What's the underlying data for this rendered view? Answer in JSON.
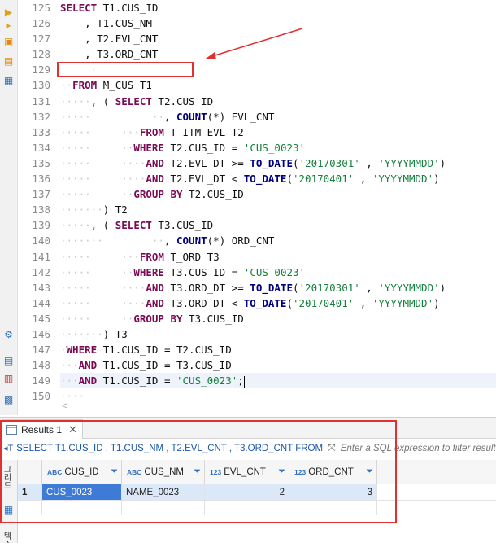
{
  "editor": {
    "line_numbers": [
      "125",
      "126",
      "127",
      "128",
      "129",
      "130",
      "131",
      "132",
      "133",
      "134",
      "135",
      "136",
      "137",
      "138",
      "139",
      "140",
      "141",
      "142",
      "143",
      "144",
      "145",
      "146",
      "147",
      "148",
      "149",
      "150"
    ],
    "lines": [
      [
        {
          "t": "SELECT",
          "c": "kw"
        },
        {
          "t": " T1.CUS_ID"
        }
      ],
      [
        {
          "t": "    ",
          "c": "dot"
        },
        {
          "t": ", T1.CUS_NM"
        }
      ],
      [
        {
          "t": "    ",
          "c": "dot"
        },
        {
          "t": ", T2.EVL_CNT"
        }
      ],
      [
        {
          "t": "    ",
          "c": "dot"
        },
        {
          "t": ", T3.ORD_CNT"
        }
      ],
      [
        {
          "t": "     ·",
          "c": "dot"
        }
      ],
      [
        {
          "t": "··",
          "c": "dot"
        },
        {
          "t": "FROM",
          "c": "kw"
        },
        {
          "t": " M_CUS T1"
        }
      ],
      [
        {
          "t": "·····",
          "c": "dot"
        },
        {
          "t": ", ( "
        },
        {
          "t": "SELECT",
          "c": "kw"
        },
        {
          "t": " T2.CUS_ID"
        }
      ],
      [
        {
          "t": "·····          ··",
          "c": "dot"
        },
        {
          "t": ", "
        },
        {
          "t": "COUNT",
          "c": "fn"
        },
        {
          "t": "(*) EVL_CNT"
        }
      ],
      [
        {
          "t": "·····     ···",
          "c": "dot"
        },
        {
          "t": "FROM",
          "c": "kw"
        },
        {
          "t": " T_ITM_EVL T2"
        }
      ],
      [
        {
          "t": "·····     ··",
          "c": "dot"
        },
        {
          "t": "WHERE",
          "c": "kw"
        },
        {
          "t": " T2.CUS_ID = "
        },
        {
          "t": "'CUS_0023'",
          "c": "str"
        }
      ],
      [
        {
          "t": "·····     ····",
          "c": "dot"
        },
        {
          "t": "AND",
          "c": "kw"
        },
        {
          "t": " T2.EVL_DT >= "
        },
        {
          "t": "TO_DATE",
          "c": "fn"
        },
        {
          "t": "("
        },
        {
          "t": "'20170301'",
          "c": "str"
        },
        {
          "t": " , "
        },
        {
          "t": "'YYYYMMDD'",
          "c": "str"
        },
        {
          "t": ")"
        }
      ],
      [
        {
          "t": "·····     ····",
          "c": "dot"
        },
        {
          "t": "AND",
          "c": "kw"
        },
        {
          "t": " T2.EVL_DT < "
        },
        {
          "t": "TO_DATE",
          "c": "fn"
        },
        {
          "t": "("
        },
        {
          "t": "'20170401'",
          "c": "str"
        },
        {
          "t": " , "
        },
        {
          "t": "'YYYYMMDD'",
          "c": "str"
        },
        {
          "t": ")"
        }
      ],
      [
        {
          "t": "·····     ··",
          "c": "dot"
        },
        {
          "t": "GROUP BY",
          "c": "kw"
        },
        {
          "t": " T2.CUS_ID"
        }
      ],
      [
        {
          "t": "·······",
          "c": "dot"
        },
        {
          "t": ") T2"
        }
      ],
      [
        {
          "t": "·····",
          "c": "dot"
        },
        {
          "t": ", ( "
        },
        {
          "t": "SELECT",
          "c": "kw"
        },
        {
          "t": " T3.CUS_ID"
        }
      ],
      [
        {
          "t": "·······        ··",
          "c": "dot"
        },
        {
          "t": ", "
        },
        {
          "t": "COUNT",
          "c": "fn"
        },
        {
          "t": "(*) ORD_CNT"
        }
      ],
      [
        {
          "t": "·····     ···",
          "c": "dot"
        },
        {
          "t": "FROM",
          "c": "kw"
        },
        {
          "t": " T_ORD T3"
        }
      ],
      [
        {
          "t": "·····     ··",
          "c": "dot"
        },
        {
          "t": "WHERE",
          "c": "kw"
        },
        {
          "t": " T3.CUS_ID = "
        },
        {
          "t": "'CUS_0023'",
          "c": "str"
        }
      ],
      [
        {
          "t": "·····     ····",
          "c": "dot"
        },
        {
          "t": "AND",
          "c": "kw"
        },
        {
          "t": " T3.ORD_DT >= "
        },
        {
          "t": "TO_DATE",
          "c": "fn"
        },
        {
          "t": "("
        },
        {
          "t": "'20170301'",
          "c": "str"
        },
        {
          "t": " , "
        },
        {
          "t": "'YYYYMMDD'",
          "c": "str"
        },
        {
          "t": ")"
        }
      ],
      [
        {
          "t": "·····     ····",
          "c": "dot"
        },
        {
          "t": "AND",
          "c": "kw"
        },
        {
          "t": " T3.ORD_DT < "
        },
        {
          "t": "TO_DATE",
          "c": "fn"
        },
        {
          "t": "("
        },
        {
          "t": "'20170401'",
          "c": "str"
        },
        {
          "t": " , "
        },
        {
          "t": "'YYYYMMDD'",
          "c": "str"
        },
        {
          "t": ")"
        }
      ],
      [
        {
          "t": "·····     ··",
          "c": "dot"
        },
        {
          "t": "GROUP BY",
          "c": "kw"
        },
        {
          "t": " T3.CUS_ID"
        }
      ],
      [
        {
          "t": "·······",
          "c": "dot"
        },
        {
          "t": ") T3"
        }
      ],
      [
        {
          "t": "·",
          "c": "dot"
        },
        {
          "t": "WHERE",
          "c": "kw"
        },
        {
          "t": " T1.CUS_ID = T2.CUS_ID"
        }
      ],
      [
        {
          "t": "···",
          "c": "dot"
        },
        {
          "t": "AND",
          "c": "kw"
        },
        {
          "t": " T1.CUS_ID = T3.CUS_ID"
        }
      ],
      [
        {
          "t": "···",
          "c": "dot"
        },
        {
          "t": "AND",
          "c": "kw"
        },
        {
          "t": " T1.CUS_ID = "
        },
        {
          "t": "'CUS_0023'",
          "c": "str"
        },
        {
          "t": ";"
        }
      ],
      [
        {
          "t": "····",
          "c": "dot"
        }
      ]
    ],
    "current_line_index": 24,
    "hscroll_glyph": "<"
  },
  "results": {
    "tab_label": "Results 1",
    "tab_close": "✕",
    "query_text": "SELECT T1.CUS_ID , T1.CUS_NM , T2.EVL_CNT , T3.ORD_CNT FROM",
    "filter_placeholder": "Enter a SQL expression to filter results",
    "side_label": "그리드",
    "columns": [
      {
        "type": "ABC",
        "name": "CUS_ID"
      },
      {
        "type": "ABC",
        "name": "CUS_NM"
      },
      {
        "type": "123",
        "name": "EVL_CNT"
      },
      {
        "type": "123",
        "name": "ORD_CNT"
      }
    ],
    "rows": [
      {
        "num": "1",
        "cells": [
          "CUS_0023",
          "NAME_0023",
          "2",
          "3"
        ]
      }
    ],
    "bottom_side_label": "텍스트"
  },
  "colors": {
    "annotation": "#e03131",
    "keyword": "#7b0a55",
    "function": "#00007f",
    "string": "#15803d"
  }
}
